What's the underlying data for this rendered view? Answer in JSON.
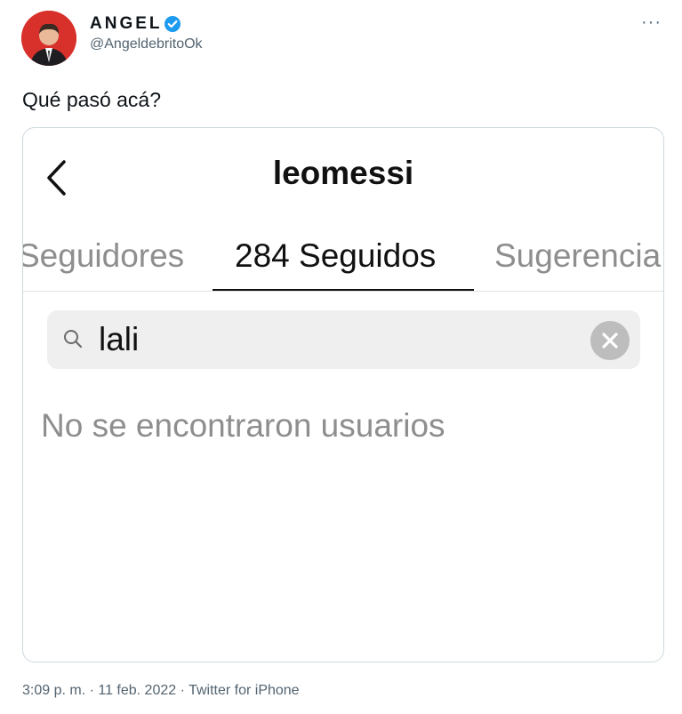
{
  "tweet": {
    "display_name": "ANGEL",
    "handle": "@AngeldebritoOk",
    "more_label": "···",
    "text": "Qué pasó acá?",
    "meta": "3:09 p. m. · 11 feb. 2022 · Twitter for iPhone"
  },
  "screenshot": {
    "title": "leomessi",
    "tabs": [
      {
        "label": "Seguidores"
      },
      {
        "label": "284 Seguidos"
      },
      {
        "label": "Sugerencia"
      }
    ],
    "search": {
      "value": "lali"
    },
    "empty_message": "No se encontraron usuarios"
  },
  "colors": {
    "verified": "#1d9bf0",
    "secondary_text": "#536471",
    "ig_gray": "#8e8e8e"
  }
}
